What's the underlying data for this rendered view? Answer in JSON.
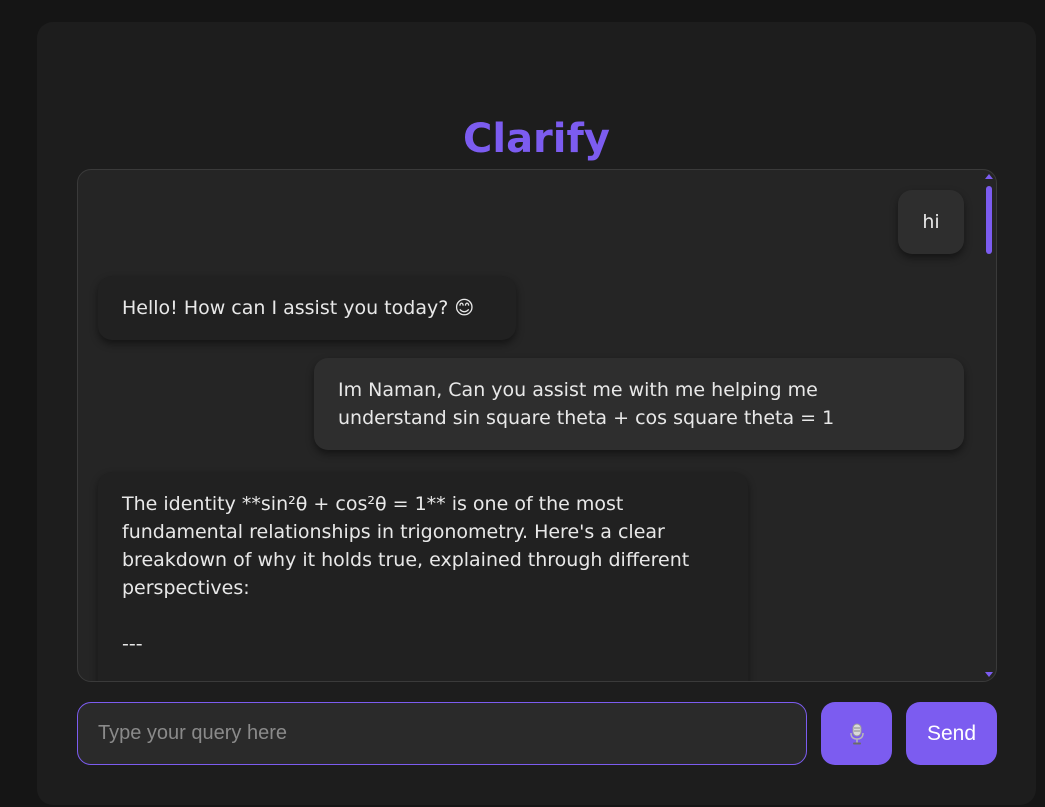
{
  "app": {
    "title": "Clarify"
  },
  "messages": [
    {
      "role": "user",
      "text": "hi"
    },
    {
      "role": "assistant",
      "text": "Hello! How can I assist you today? 😊"
    },
    {
      "role": "user",
      "text": "Im Naman, Can you assist me with me helping me\nunderstand sin square theta + cos square theta = 1"
    },
    {
      "role": "assistant",
      "text": "The identity **sin²θ + cos²θ = 1** is one of the most\nfundamental relationships in trigonometry. Here's a clear\nbreakdown of why it holds true, explained through different\nperspectives:\n\n---"
    }
  ],
  "composer": {
    "placeholder": "Type your query here",
    "value": "",
    "mic_icon": "microphone-icon",
    "send_label": "Send"
  },
  "colors": {
    "accent": "#7c5cf0",
    "background": "#151515",
    "card": "#1d1d1d",
    "bubble": "#2e2e2e"
  }
}
